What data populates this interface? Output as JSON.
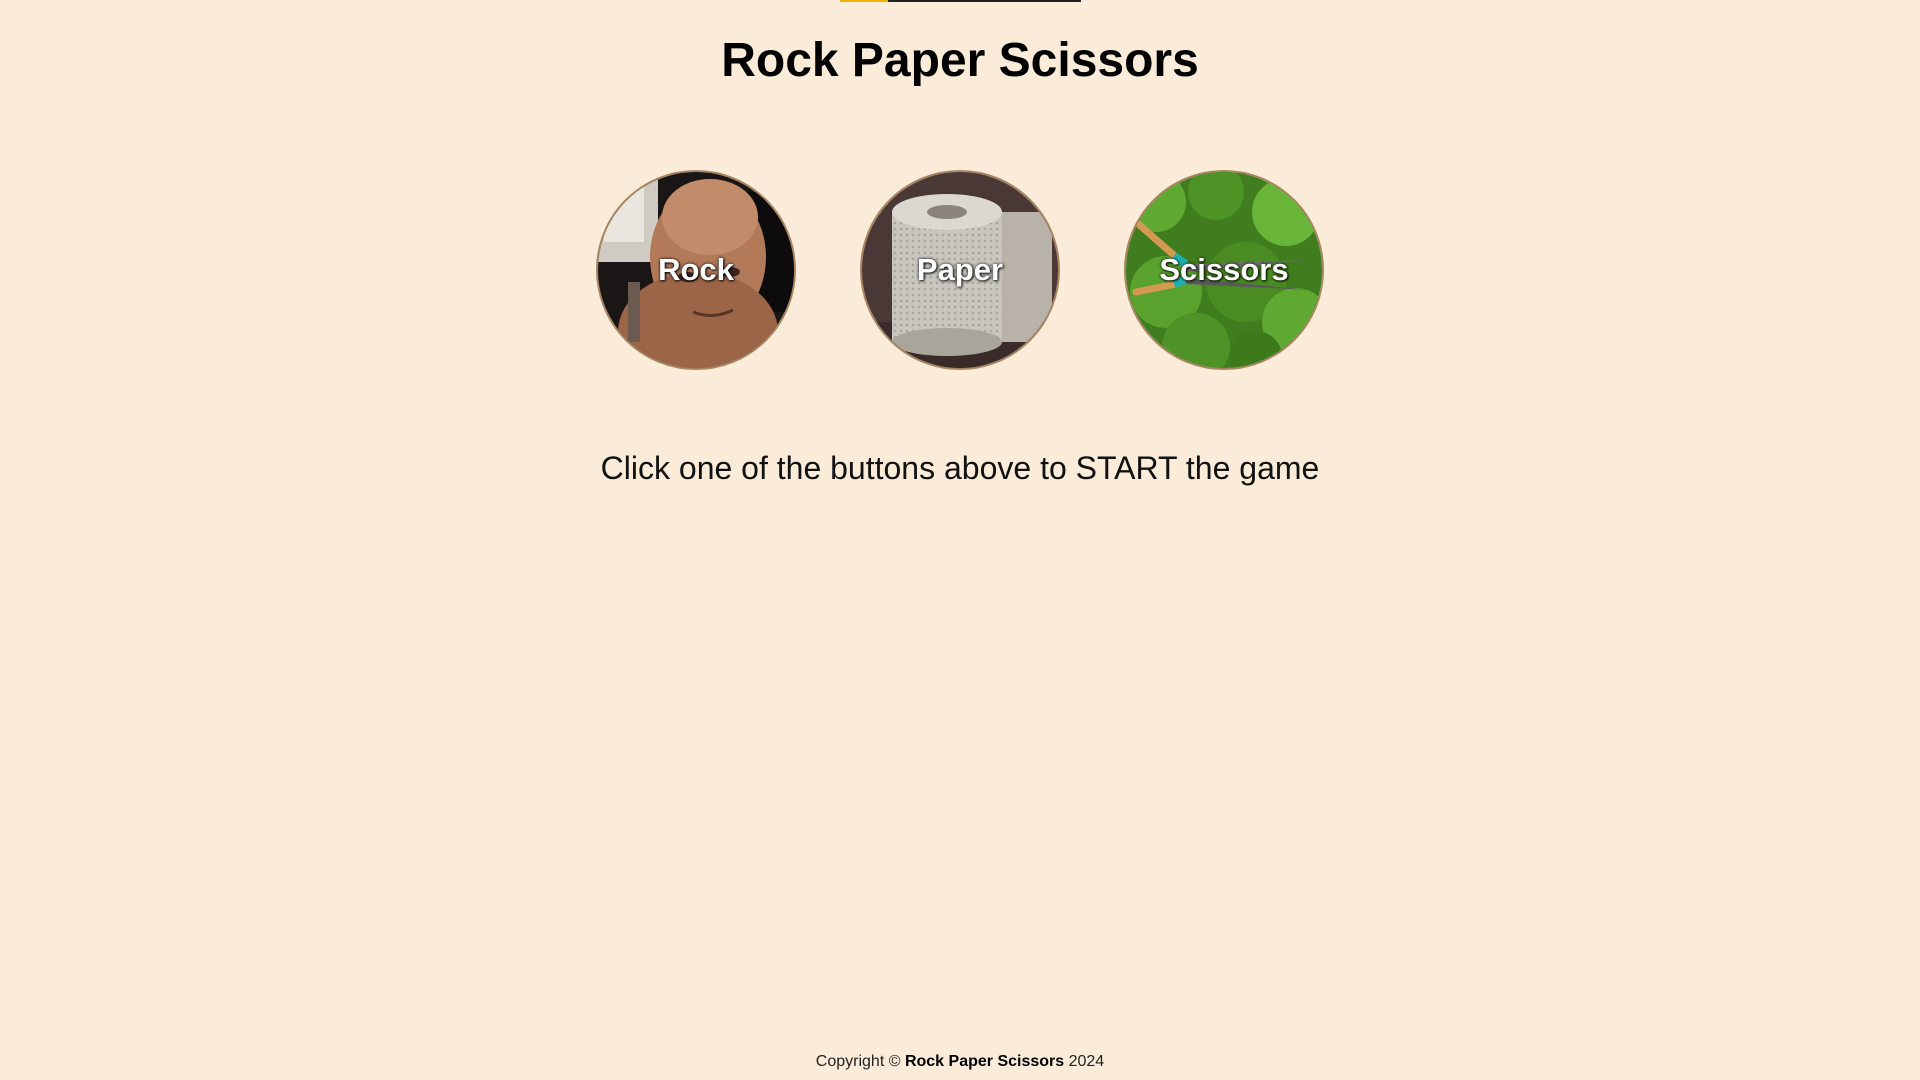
{
  "page": {
    "title": "Rock Paper Scissors",
    "prompt": "Click one of the buttons above to START the game"
  },
  "choices": [
    {
      "label": "Rock",
      "image": "rock-photo"
    },
    {
      "label": "Paper",
      "image": "toilet-paper-photo"
    },
    {
      "label": "Scissors",
      "image": "hedge-shears-photo"
    }
  ],
  "footer": {
    "prefix": "Copyright ©",
    "brand": "Rock Paper Scissors",
    "year": "2024"
  },
  "colors": {
    "background": "#FBECD9",
    "button_border": "#A68560",
    "accent": "#F0B400"
  }
}
